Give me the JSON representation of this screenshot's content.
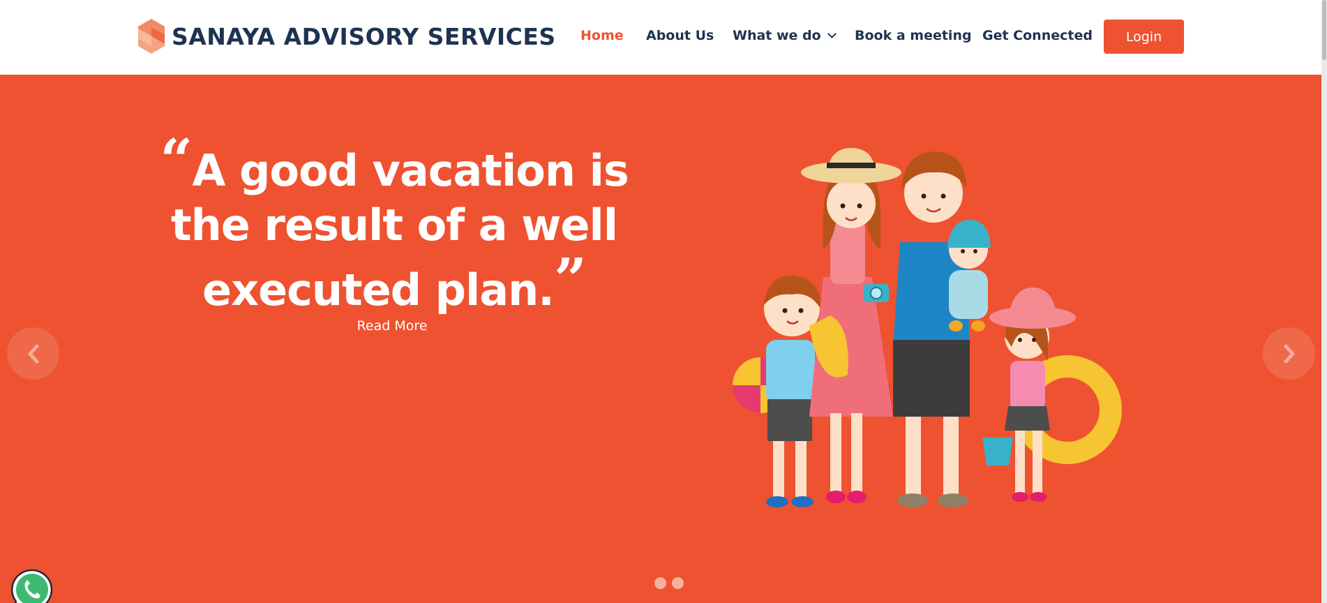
{
  "header": {
    "brand": "SANAYA ADVISORY SERVICES",
    "logo_icon": "hexagon-s-logo",
    "nav": [
      {
        "label": "Home",
        "active": true
      },
      {
        "label": "About Us"
      },
      {
        "label": "What we do",
        "has_dropdown": true
      },
      {
        "label": "Book a meeting"
      },
      {
        "label": "Get Connected"
      }
    ],
    "login_label": "Login"
  },
  "hero": {
    "quote_open": "“",
    "quote_text": "A good vacation is the result of a well executed plan.",
    "quote_close": "”",
    "read_more": "Read More",
    "illustration": "family-vacation-illustration",
    "slide_count": 2,
    "active_slide": 1
  },
  "icons": {
    "prev": "chevron-left-icon",
    "next": "chevron-right-icon",
    "whatsapp": "whatsapp-icon",
    "dropdown": "chevron-down-icon"
  },
  "colors": {
    "brand_orange": "#ee5230",
    "navy": "#1e3350",
    "white": "#ffffff",
    "whatsapp_green": "#3dba6f"
  }
}
